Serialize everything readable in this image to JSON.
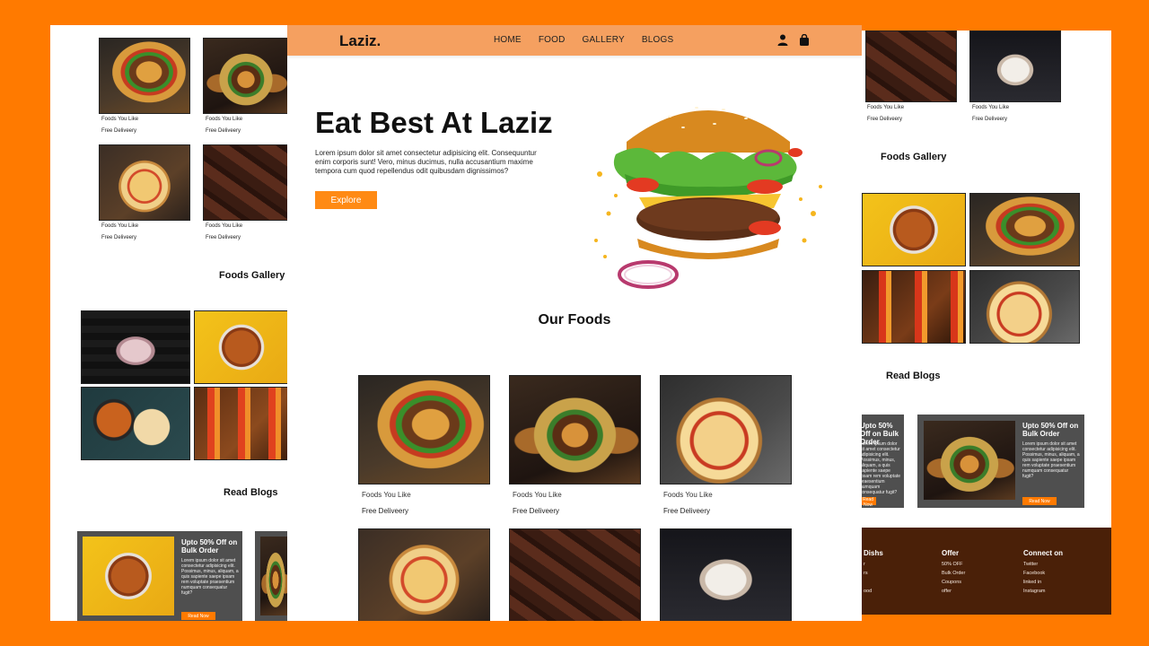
{
  "brand": {
    "logo": "Laziz."
  },
  "nav": {
    "items": [
      "HOME",
      "FOOD",
      "GALLERY",
      "BLOGS"
    ],
    "user_icon": "user-icon",
    "cart_icon": "bag-icon"
  },
  "hero": {
    "title": "Eat Best At Laziz",
    "text": "Lorem ipsum dolor sit amet consectetur adipisicing elit. Consequuntur enim corporis sunt! Vero, minus ducimus, nulla accusantium maxime tempora cum quod repellendus odit quibusdam dignissimos?",
    "button": "Explore"
  },
  "sections": {
    "our_foods": "Our Foods",
    "foods_gallery": "Foods Gallery",
    "read_blogs": "Read Blogs"
  },
  "food_card": {
    "caption": "Foods You Like",
    "delivery": "Free Deliveery"
  },
  "blog": {
    "title": "Upto 50% Off on Bulk Order",
    "text": "Lorem ipsum dolor sit amet consectetur adipisicing elit. Possimus, minus, aliquam, a quis sapiente saepe ipsam rem voluptate praesentium numquam consequatur fugit?",
    "button": "Read Now"
  },
  "footer": {
    "col1": {
      "title": "Dishs",
      "items": [
        "r",
        "rs",
        "",
        "ood"
      ]
    },
    "col2": {
      "title": "Offer",
      "items": [
        "50% OFF",
        "Bulk Order",
        "Coupons",
        "offer"
      ]
    },
    "col3": {
      "title": "Connect on",
      "items": [
        "Twitter",
        "Facebook",
        "linked in",
        "Instagram"
      ]
    }
  },
  "colors": {
    "accent": "#ff7a00",
    "nav": "#f5a060",
    "footer": "#4a2008",
    "blog_card": "#4f4f4f"
  }
}
